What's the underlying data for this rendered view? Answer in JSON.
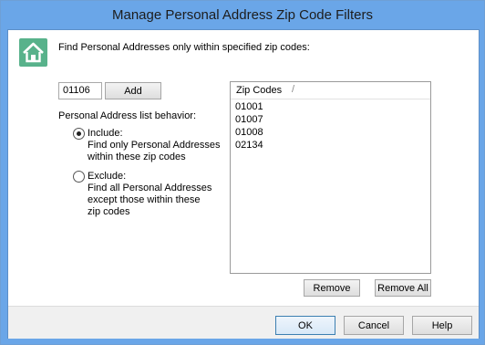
{
  "window": {
    "title": "Manage Personal Address Zip Code Filters"
  },
  "prompt": "Find Personal Addresses only within specified zip codes:",
  "zip_input": {
    "value": "01106"
  },
  "add_label": "Add",
  "behavior_label": "Personal Address list behavior:",
  "include": {
    "label": "Include:",
    "desc1": "Find only Personal Addresses",
    "desc2": "within these zip codes",
    "selected": true
  },
  "exclude": {
    "label": "Exclude:",
    "desc1": "Find all Personal Addresses",
    "desc2": "except those within these",
    "desc3": "zip codes",
    "selected": false
  },
  "list": {
    "header": "Zip Codes",
    "items": [
      "01001",
      "01007",
      "01008",
      "02134"
    ]
  },
  "remove_label": "Remove",
  "remove_all_label": "Remove All",
  "ok_label": "OK",
  "cancel_label": "Cancel",
  "help_label": "Help",
  "colors": {
    "titlebar": "#6aa6e8",
    "house_tile": "#58b28b",
    "footer": "#f0f0f0"
  }
}
